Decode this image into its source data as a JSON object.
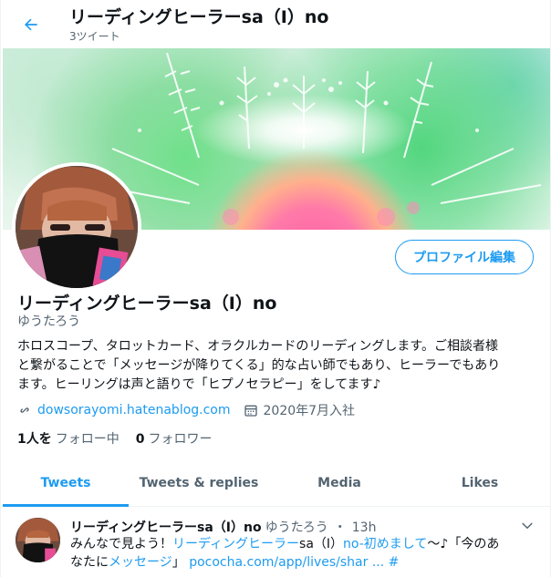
{
  "header": {
    "title": "リーディングヒーラーsa（I）no",
    "subtitle": "3ツイート",
    "back_icon": "arrow-left-icon"
  },
  "profile": {
    "name": "リーディングヒーラーsa（I）no",
    "handle": "ゆうたろう",
    "edit_label": "プロファイル編集",
    "bio_line1": "ホロスコープ、タロットカード、オラクルカードのリーディングします。ご相談者様",
    "bio_line2": "と繋がることで「メッセージが降りてくる」的な占い師でもあり、ヒーラーでもあり",
    "bio_line3": "ます。ヒーリングは声と語りで「ヒプノセラピー」をしてます♪",
    "website": "dowsorayomi.hatenablog.com",
    "joined": "2020年7月入社",
    "following_count": "1人を",
    "following_label": "フォロー中",
    "followers_count": "0",
    "followers_label": "フォロワー"
  },
  "tabs": [
    {
      "label": "Tweets",
      "active": true
    },
    {
      "label": "Tweets & replies",
      "active": false
    },
    {
      "label": "Media",
      "active": false
    },
    {
      "label": "Likes",
      "active": false
    }
  ],
  "tweet": {
    "name": "リーディングヒーラーsa（I）no",
    "handle": "ゆうたろう",
    "separator": "・",
    "time": "13h",
    "text1_a": "みんなで見よう！",
    "text1_link1": "リーディングヒーラー",
    "text1_b": "sa（I）",
    "text1_link2": "no-初めまして",
    "text1_c": "〜♪「今のあ",
    "text2_a": "なたに",
    "text2_link1": "メッセージ",
    "text2_b": "」",
    "text2_link2": "pococha.com/app/lives/shar ...",
    "text2_link3": "#"
  },
  "colors": {
    "accent": "#1d9bf0",
    "secondary_text": "#536471",
    "primary_text": "#0f1419"
  }
}
